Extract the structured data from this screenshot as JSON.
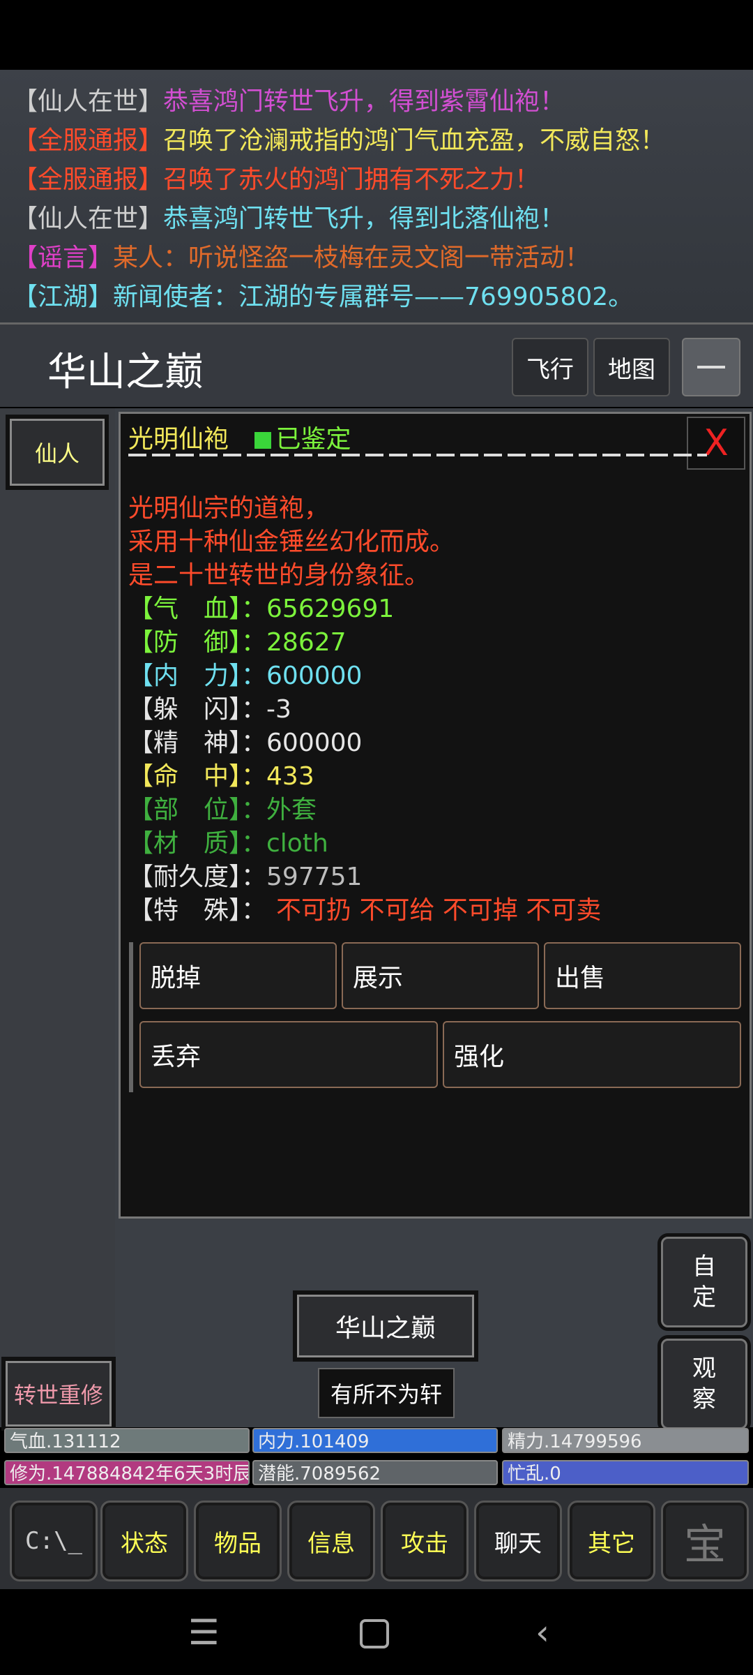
{
  "chat": {
    "lines": [
      {
        "tag": "【仙人在世】",
        "msg": "恭喜鸿门转世飞升，得到紫霄仙袍！",
        "tag_color": "#cfcfcf",
        "msg_color": "#d24fd2"
      },
      {
        "tag": "【全服通报】",
        "msg": "召唤了沧澜戒指的鸿门气血充盈，不威自怒！",
        "tag_color": "#ff4b2b",
        "msg_color": "#f2e85a"
      },
      {
        "tag": "【全服通报】",
        "msg": "召唤了赤火的鸿门拥有不死之力！",
        "tag_color": "#ff4b2b",
        "msg_color": "#ff4b2b"
      },
      {
        "tag": "【仙人在世】",
        "msg": "恭喜鸿门转世飞升，得到北落仙袍！",
        "tag_color": "#cfcfcf",
        "msg_color": "#6fe0f0"
      },
      {
        "tag": "【谣言】",
        "msg": "某人：听说怪盗一枝梅在灵文阁一带活动！",
        "tag_color": "#e040c8",
        "msg_color": "#e06a2a"
      },
      {
        "tag": "【江湖】",
        "msg": "新闻使者：江湖的专属群号——769905802。",
        "tag_color": "#6fe0f0",
        "msg_color": "#6fe0f0"
      }
    ]
  },
  "header": {
    "location": "华山之巅",
    "fly_label": "飞行",
    "map_label": "地图"
  },
  "side": {
    "xianren_label": "仙人",
    "rebirth_label": "转世重修",
    "custom_label_1": "自",
    "custom_label_2": "定",
    "observe_label_1": "观",
    "observe_label_2": "察"
  },
  "item": {
    "name": "光明仙袍",
    "status_icon": "green-square",
    "status": "已鉴定",
    "close_label": "X",
    "desc": [
      "光明仙宗的道袍，",
      "采用十种仙金锤丝幻化而成。",
      "是二十世转世的身份象征。"
    ],
    "attrs": [
      {
        "label": "【气　血】：",
        "value": "65629691",
        "color": "#7cf33c"
      },
      {
        "label": "【防　御】：",
        "value": "28627",
        "color": "#7cf33c"
      },
      {
        "label": "【内　力】：",
        "value": "600000",
        "color": "#6fe0f0"
      },
      {
        "label": "【躲　闪】：",
        "value": "-3",
        "color": "#e6e6e6"
      },
      {
        "label": "【精　神】：",
        "value": "600000",
        "color": "#e6e6e6"
      },
      {
        "label": "【命　中】：",
        "value": "433",
        "color": "#f2e85a"
      },
      {
        "label": "【部　位】：",
        "value": "外套",
        "color": "#3fb03f"
      },
      {
        "label": "【材　质】：",
        "value": "cloth",
        "color": "#3fb03f"
      },
      {
        "label": "【耐久度】：",
        "value": "597751",
        "color": "#e6e6e6",
        "value_color": "#bdbdbd"
      }
    ],
    "special_label": "【特　殊】：",
    "special_value": "不可扔 不可给 不可掉 不可卖",
    "actions": [
      "脱掉",
      "展示",
      "出售",
      "丢弃",
      "强化"
    ]
  },
  "location_button": "华山之巅",
  "guild_button": "有所不为轩",
  "stats": {
    "hp": "气血.131112",
    "neili": "内力.101409",
    "jingli": "精力.14799596",
    "xiuwei": "修为.147884842年6天3时辰",
    "qianneng": "潜能.7089562",
    "mangluan": "忙乱.0"
  },
  "nav": {
    "console_label": "C:\\_",
    "items": [
      "状态",
      "物品",
      "信息",
      "攻击",
      "聊天",
      "其它"
    ],
    "logo_char": "宝"
  },
  "colors": {
    "hp_bar": "#6e7a7a",
    "neili_bar": "#2f6fd8",
    "jingli_bar": "#8a8e92",
    "xiuwei_bar": "#b23a80",
    "qianneng_bar": "#5f6468",
    "mangluan_bar": "#4c5fc8"
  }
}
